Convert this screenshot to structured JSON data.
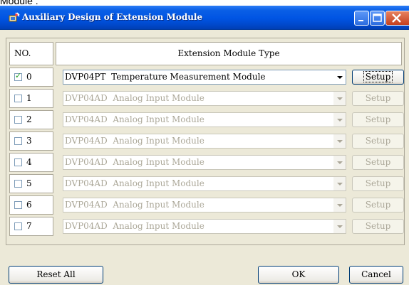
{
  "caption": "Module :",
  "window": {
    "title": "Auxiliary Design of Extension Module"
  },
  "header": {
    "no_label": "NO.",
    "type_label": "Extension Module Type"
  },
  "rows": [
    {
      "num": "0",
      "checked": true,
      "value": "DVP04PT  Temperature Measurement Module",
      "enabled": true,
      "setup": "Setup"
    },
    {
      "num": "1",
      "checked": false,
      "value": "DVP04AD  Analog Input Module",
      "enabled": false,
      "setup": "Setup"
    },
    {
      "num": "2",
      "checked": false,
      "value": "DVP04AD  Analog Input Module",
      "enabled": false,
      "setup": "Setup"
    },
    {
      "num": "3",
      "checked": false,
      "value": "DVP04AD  Analog Input Module",
      "enabled": false,
      "setup": "Setup"
    },
    {
      "num": "4",
      "checked": false,
      "value": "DVP04AD  Analog Input Module",
      "enabled": false,
      "setup": "Setup"
    },
    {
      "num": "5",
      "checked": false,
      "value": "DVP04AD  Analog Input Module",
      "enabled": false,
      "setup": "Setup"
    },
    {
      "num": "6",
      "checked": false,
      "value": "DVP04AD  Analog Input Module",
      "enabled": false,
      "setup": "Setup"
    },
    {
      "num": "7",
      "checked": false,
      "value": "DVP04AD  Analog Input Module",
      "enabled": false,
      "setup": "Setup"
    }
  ],
  "buttons": {
    "reset_all": "Reset All",
    "ok": "OK",
    "cancel": "Cancel"
  },
  "icons": {
    "title": "app-module-icon",
    "minimize": "minimize-icon",
    "maximize": "maximize-icon",
    "close": "close-icon"
  },
  "colors": {
    "titlebar": "#0054e3",
    "close_button": "#c3401f",
    "dialog_face": "#ece9d8",
    "checkmark": "#21a121",
    "disabled_text": "#aca899"
  }
}
